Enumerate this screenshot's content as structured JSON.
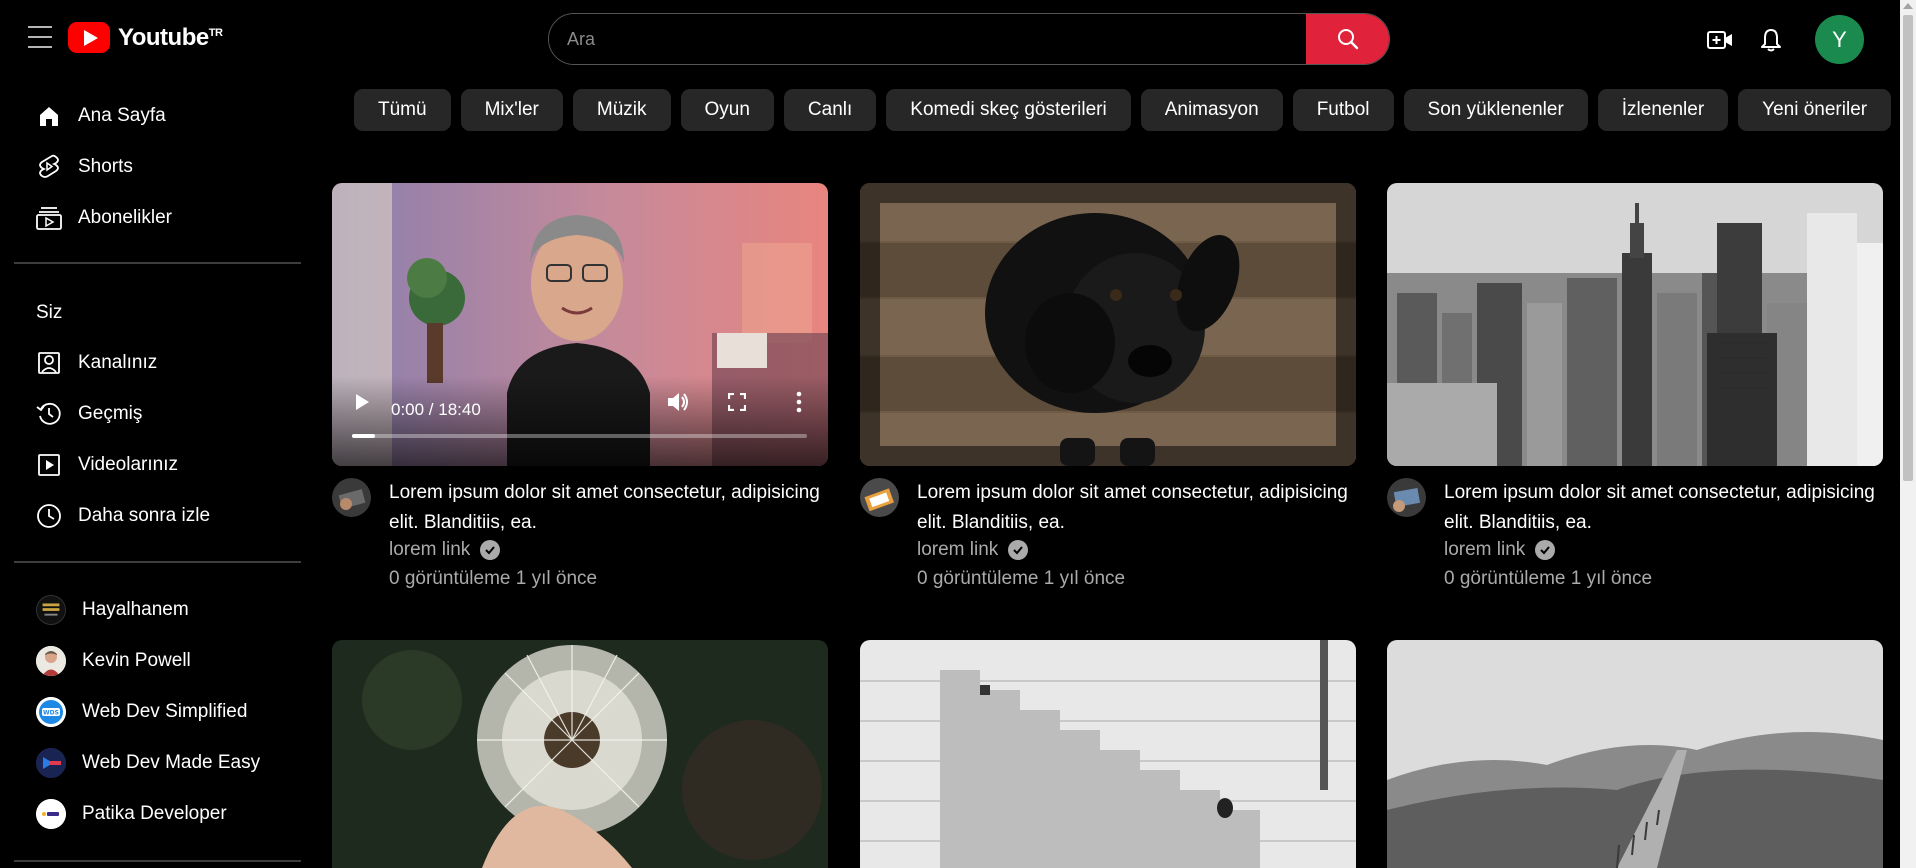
{
  "header": {
    "logo_text": "Youtube",
    "logo_sup": "TR",
    "search_placeholder": "Ara",
    "avatar_letter": "Y"
  },
  "sidebar": {
    "main": [
      {
        "label": "Ana Sayfa",
        "icon": "home-icon"
      },
      {
        "label": "Shorts",
        "icon": "shorts-icon"
      },
      {
        "label": "Abonelikler",
        "icon": "subscriptions-icon"
      }
    ],
    "you_title": "Siz",
    "you": [
      {
        "label": "Kanalınız",
        "icon": "channel-icon"
      },
      {
        "label": "Geçmiş",
        "icon": "history-icon"
      },
      {
        "label": "Videolarınız",
        "icon": "your-videos-icon"
      },
      {
        "label": "Daha sonra izle",
        "icon": "watch-later-icon"
      }
    ],
    "channels": [
      {
        "label": "Hayalhanem"
      },
      {
        "label": "Kevin Powell"
      },
      {
        "label": "Web Dev Simplified"
      },
      {
        "label": "Web Dev Made Easy"
      },
      {
        "label": "Patika Developer"
      }
    ]
  },
  "chips": [
    "Tümü",
    "Mix'ler",
    "Müzik",
    "Oyun",
    "Canlı",
    "Komedi skeç gösterileri",
    "Animasyon",
    "Futbol",
    "Son yüklenenler",
    "İzlenenler",
    "Yeni öneriler"
  ],
  "video_player": {
    "time": "0:00 / 18:40",
    "progress": 0.05
  },
  "cards": [
    {
      "title": "Lorem ipsum dolor sit amet consectetur, adipisicing elit. Blanditiis, ea.",
      "channel": "lorem link",
      "stats": "0 görüntüleme 1 yıl önce"
    },
    {
      "title": "Lorem ipsum dolor sit amet consectetur, adipisicing elit. Blanditiis, ea.",
      "channel": "lorem link",
      "stats": "0 görüntüleme 1 yıl önce"
    },
    {
      "title": "Lorem ipsum dolor sit amet consectetur, adipisicing elit. Blanditiis, ea.",
      "channel": "lorem link",
      "stats": "0 görüntüleme 1 yıl önce"
    }
  ],
  "colors": {
    "background": "#000000",
    "chip": "#272727",
    "search_button": "#e0233a",
    "logo_red": "#ff0000",
    "avatar": "#1b8a4e",
    "muted_text": "#aaaaaa"
  }
}
